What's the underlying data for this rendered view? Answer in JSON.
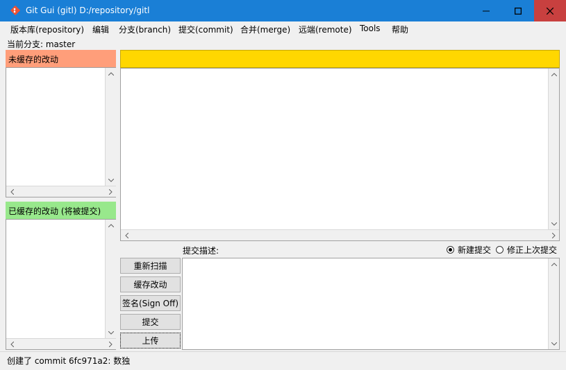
{
  "window": {
    "title": "Git Gui (gitl) D:/repository/gitl"
  },
  "colors": {
    "titlebar": "#1a7fd6",
    "close": "#c8403f",
    "unstaged_header": "#ff9e7a",
    "staged_header": "#98e88c",
    "diff_header": "#ffd700"
  },
  "menu": [
    "版本库(repository)",
    "编辑",
    "分支(branch)",
    "提交(commit)",
    "合并(merge)",
    "远端(remote)",
    "Tools",
    "帮助"
  ],
  "branch": {
    "label": "当前分支: master"
  },
  "unstaged": {
    "header": "未缓存的改动"
  },
  "staged": {
    "header": "已缓存的改动 (将被提交)"
  },
  "commit": {
    "message_label": "提交描述:",
    "radio_new": "新建提交",
    "radio_amend": "修正上次提交",
    "buttons": [
      "重新扫描",
      "缓存改动",
      "签名(Sign Off)",
      "提交",
      "上传"
    ]
  },
  "status": {
    "text": "创建了 commit 6fc971a2: 数独"
  }
}
